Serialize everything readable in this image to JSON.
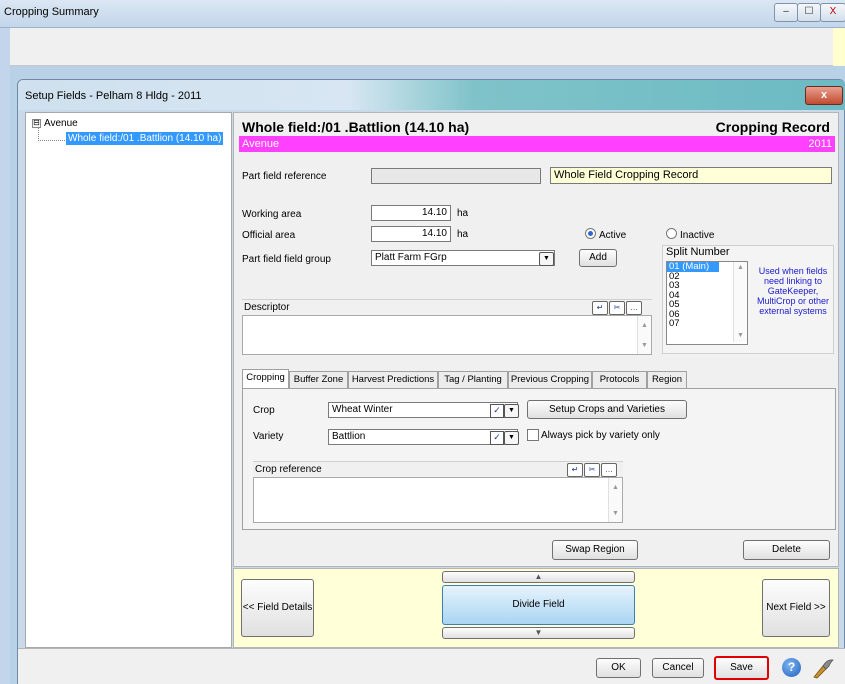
{
  "outer_window": {
    "title": "Cropping Summary",
    "minimize": "–",
    "maximize": "☐",
    "close": "X"
  },
  "dialog": {
    "title": "Setup Fields - Pelham 8 Hldg - 2011",
    "close": "x"
  },
  "tree": {
    "root": "Avenue",
    "expander": "⊟",
    "child": "Whole field:/01 .Battlion (14.10 ha)"
  },
  "header": {
    "field_title": "Whole field:/01 .Battlion (14.10 ha)",
    "record_title": "Cropping Record",
    "farm": "Avenue",
    "year": "2011"
  },
  "form": {
    "part_field_reference_label": "Part field reference",
    "part_field_reference_value": "",
    "cropping_record_value": "Whole Field Cropping Record",
    "working_area_label": "Working area",
    "working_area_value": "14.10",
    "working_area_unit": "ha",
    "official_area_label": "Official area",
    "official_area_value": "14.10",
    "official_area_unit": "ha",
    "active_label": "Active",
    "inactive_label": "Inactive",
    "part_field_group_label": "Part field field group",
    "part_field_group_value": "Platt Farm FGrp",
    "add_label": "Add",
    "descriptor_label": "Descriptor"
  },
  "split": {
    "title": "Split Number",
    "items": [
      "01 (Main)",
      "02",
      "03",
      "04",
      "05",
      "06",
      "07"
    ],
    "note": "Used when fields need linking to GateKeeper, MultiCrop or other external systems"
  },
  "tabs": [
    {
      "label": "Cropping"
    },
    {
      "label": "Buffer Zone"
    },
    {
      "label": "Harvest Predictions"
    },
    {
      "label": "Tag / Planting"
    },
    {
      "label": "Previous Cropping"
    },
    {
      "label": "Protocols"
    },
    {
      "label": "Region"
    }
  ],
  "cropping": {
    "crop_label": "Crop",
    "crop_value": "Wheat Winter",
    "variety_label": "Variety",
    "variety_value": "Battlion",
    "setup_crops_label": "Setup Crops and Varieties",
    "always_pick_label": "Always pick by variety only",
    "crop_reference_label": "Crop reference"
  },
  "actions": {
    "swap_region": "Swap Region",
    "delete": "Delete"
  },
  "nav": {
    "field_details": "<< Field Details",
    "divide_field": "Divide Field",
    "next_field": "Next Field >>"
  },
  "footer": {
    "ok": "OK",
    "cancel": "Cancel",
    "save": "Save",
    "help": "?"
  },
  "colors": {
    "header_bar": "#ff40ff",
    "selection": "#3399ff",
    "save_highlight": "#e00000",
    "nav_background": "#ffffd8"
  }
}
